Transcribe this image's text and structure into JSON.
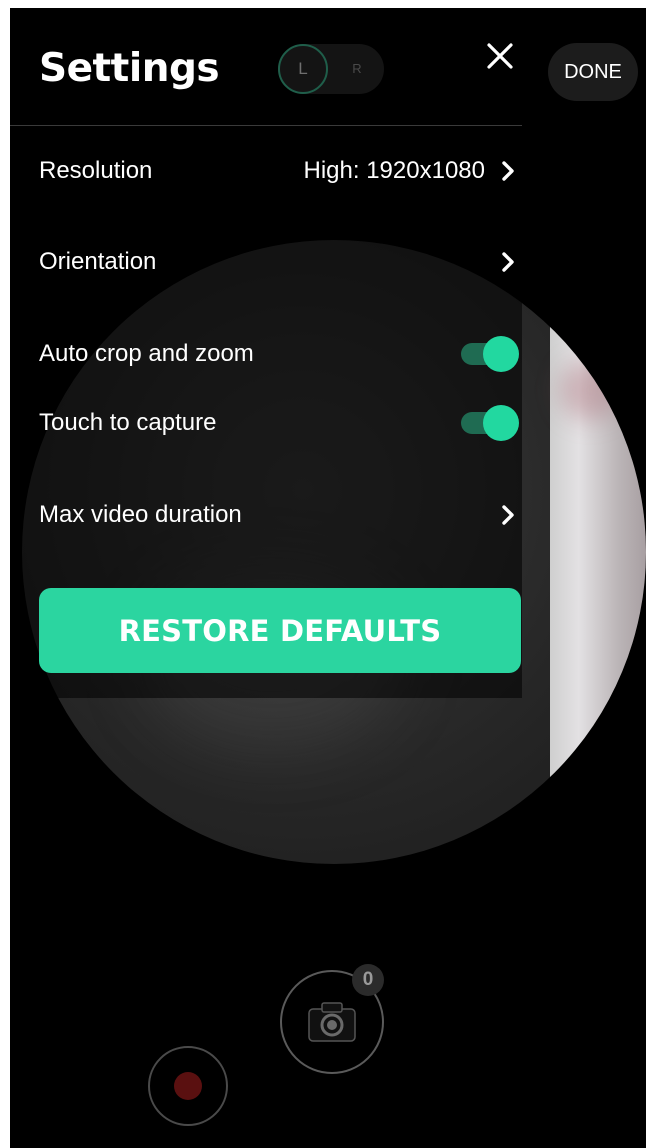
{
  "header": {
    "title": "Settings",
    "lr_toggle": {
      "left": "L",
      "right": "R"
    },
    "close_icon": "close-icon",
    "done_label": "DONE"
  },
  "settings": {
    "resolution": {
      "label": "Resolution",
      "value": "High: 1920x1080"
    },
    "orientation": {
      "label": "Orientation"
    },
    "auto_crop": {
      "label": "Auto crop and zoom",
      "enabled": true
    },
    "touch_capture": {
      "label": "Touch to capture",
      "enabled": true
    },
    "max_video": {
      "label": "Max video duration"
    },
    "restore_label": "RESTORE DEFAULTS"
  },
  "controls": {
    "capture_count": "0",
    "capture_icon": "camera-icon",
    "record_icon": "record-icon"
  },
  "colors": {
    "accent": "#2bd5a0",
    "toggle_track": "#1f6b52",
    "background": "#000000"
  }
}
